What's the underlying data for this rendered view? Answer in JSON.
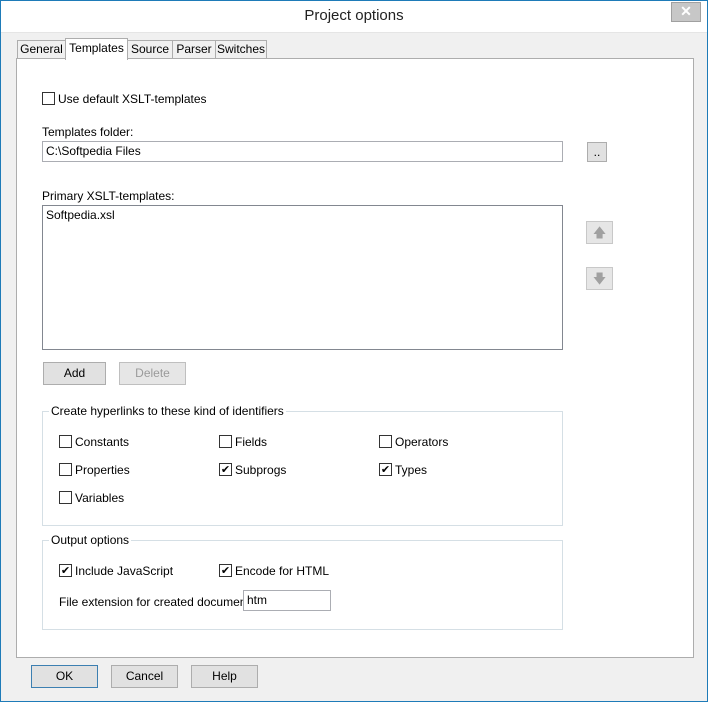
{
  "window": {
    "title": "Project options"
  },
  "tabs": [
    {
      "label": "General"
    },
    {
      "label": "Templates"
    },
    {
      "label": "Source"
    },
    {
      "label": "Parser"
    },
    {
      "label": "Switches"
    }
  ],
  "templates": {
    "use_default_label": "Use default XSLT-templates",
    "use_default_checked": false,
    "folder_label": "Templates folder:",
    "folder_value": "C:\\Softpedia Files",
    "browse_label": "..",
    "primary_label": "Primary XSLT-templates:",
    "primary_items": [
      "Softpedia.xsl"
    ],
    "add_label": "Add",
    "delete_label": "Delete",
    "move_up_icon": "arrow-up-icon",
    "move_down_icon": "arrow-down-icon"
  },
  "hyperlinks": {
    "title": "Create hyperlinks to these kind of identifiers",
    "items": [
      {
        "label": "Constants",
        "checked": false
      },
      {
        "label": "Fields",
        "checked": false
      },
      {
        "label": "Operators",
        "checked": false
      },
      {
        "label": "Properties",
        "checked": false
      },
      {
        "label": "Subprogs",
        "checked": true
      },
      {
        "label": "Types",
        "checked": true
      },
      {
        "label": "Variables",
        "checked": false
      }
    ]
  },
  "output": {
    "title": "Output options",
    "include_js_label": "Include JavaScript",
    "include_js_checked": true,
    "encode_html_label": "Encode for HTML",
    "encode_html_checked": true,
    "ext_label": "File extension for created documents:",
    "ext_value": "htm"
  },
  "footer": {
    "ok_label": "OK",
    "cancel_label": "Cancel",
    "help_label": "Help"
  }
}
